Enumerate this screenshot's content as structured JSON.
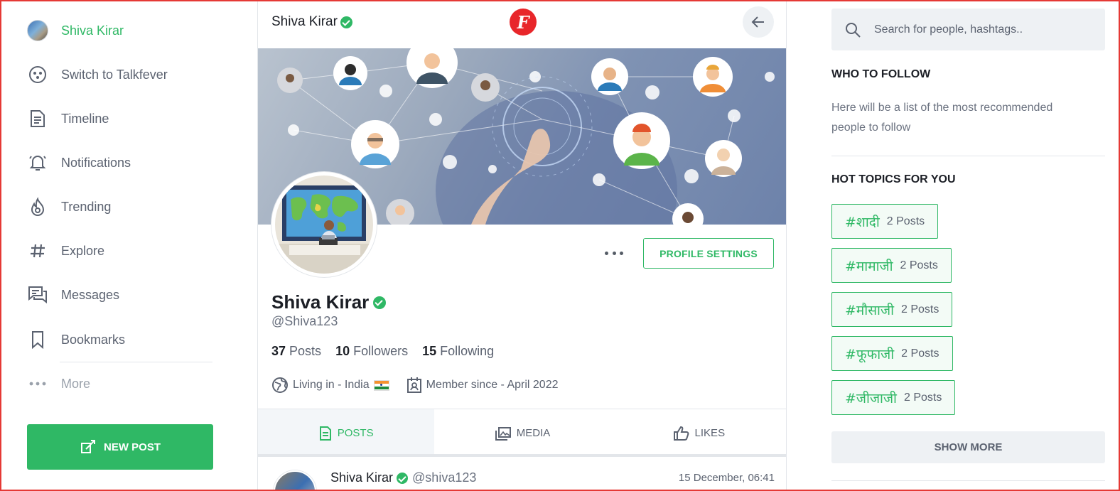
{
  "sidebar": {
    "profile_name": "Shiva Kirar",
    "items": [
      {
        "label": "Switch to Talkfever",
        "icon": "talkfever-icon"
      },
      {
        "label": "Timeline",
        "icon": "timeline-icon"
      },
      {
        "label": "Notifications",
        "icon": "bell-icon"
      },
      {
        "label": "Trending",
        "icon": "fire-icon"
      },
      {
        "label": "Explore",
        "icon": "hashtag-icon"
      },
      {
        "label": "Messages",
        "icon": "chat-icon"
      },
      {
        "label": "Bookmarks",
        "icon": "bookmark-icon"
      },
      {
        "label": "More",
        "icon": "more-dots-icon"
      }
    ],
    "new_post_label": "NEW POST"
  },
  "topbar": {
    "name": "Shiva Kirar",
    "logo_letter": "F"
  },
  "profile": {
    "name": "Shiva Kirar",
    "handle": "@Shiva123",
    "settings_label": "PROFILE SETTINGS",
    "stats": {
      "posts_count": "37",
      "posts_label": "Posts",
      "followers_count": "10",
      "followers_label": "Followers",
      "following_count": "15",
      "following_label": "Following"
    },
    "location": "Living in - India",
    "member_since": "Member since - April 2022"
  },
  "tabs": [
    {
      "label": "POSTS",
      "active": true
    },
    {
      "label": "MEDIA",
      "active": false
    },
    {
      "label": "LIKES",
      "active": false
    }
  ],
  "post": {
    "name": "Shiva Kirar",
    "handle": "@shiva123",
    "date": "15 December, 06:41"
  },
  "right": {
    "search_placeholder": "Search for people, hashtags..",
    "who_to_follow_title": "WHO TO FOLLOW",
    "who_to_follow_desc": "Here will be a list of the most recommended people to follow",
    "hot_topics_title": "HOT TOPICS FOR YOU",
    "topics": [
      {
        "tag": "#शादी",
        "count": "2 Posts"
      },
      {
        "tag": "#मामाजी",
        "count": "2 Posts"
      },
      {
        "tag": "#मौसाजी",
        "count": "2 Posts"
      },
      {
        "tag": "#फूफाजी",
        "count": "2 Posts"
      },
      {
        "tag": "#जीजाजी",
        "count": "2 Posts"
      }
    ],
    "show_more_label": "SHOW MORE"
  },
  "colors": {
    "accent": "#2fb865",
    "logo_red": "#e8262a",
    "text_muted": "#5b6270"
  }
}
